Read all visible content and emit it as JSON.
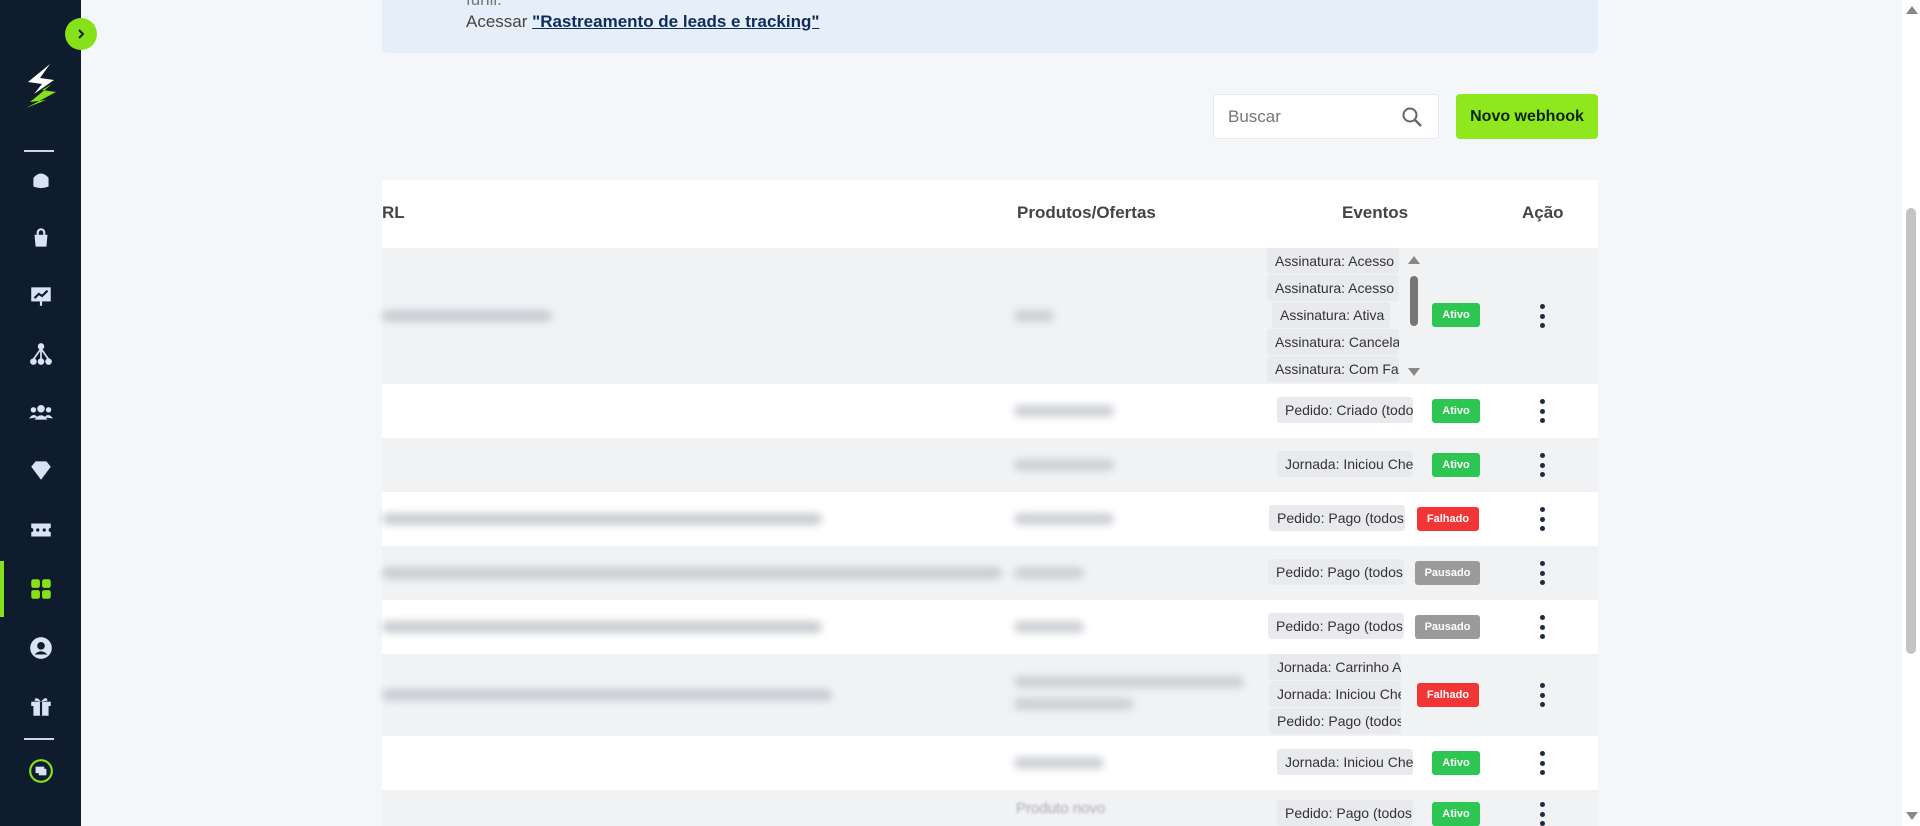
{
  "banner": {
    "prefix_line": "funil.",
    "access_text": "Acessar ",
    "link_text": "\"Rastreamento de leads e tracking\""
  },
  "search": {
    "placeholder": "Buscar"
  },
  "new_button": {
    "label": "Novo webhook"
  },
  "table": {
    "headers": {
      "url": "RL",
      "products": "Produtos/Ofertas",
      "events": "Eventos",
      "action": "Ação"
    },
    "rows": [
      {
        "events": [
          "Assinatura: Acesso L",
          "Assinatura: Acesso P",
          "Assinatura: Ativa",
          "Assinatura: Cancelad",
          "Assinatura: Com Fall"
        ],
        "status": "Ativo"
      },
      {
        "events": [
          "Pedido: Criado (todos"
        ],
        "status": "Ativo"
      },
      {
        "events": [
          "Jornada: Iniciou Che"
        ],
        "status": "Ativo"
      },
      {
        "events": [
          "Pedido: Pago (todos"
        ],
        "status": "Falhado"
      },
      {
        "events": [
          "Pedido: Pago (todos"
        ],
        "status": "Pausado"
      },
      {
        "events": [
          "Pedido: Pago (todos"
        ],
        "status": "Pausado"
      },
      {
        "events": [
          "Jornada: Carrinho Ab",
          "Jornada: Iniciou Che",
          "Pedido: Pago (todos"
        ],
        "status": "Falhado"
      },
      {
        "events": [
          "Jornada: Iniciou Che"
        ],
        "status": "Ativo"
      },
      {
        "products": "Produto novo",
        "events": [
          "Pedido: Pago (todos"
        ],
        "status": "Ativo"
      }
    ]
  },
  "colors": {
    "sidebar": "#0f1c2e",
    "accent": "#86e11b",
    "ativo": "#2dc653",
    "falhado": "#f23535",
    "pausado": "#9a9a9a"
  },
  "sidebar_icons": [
    "home-icon",
    "bag-icon",
    "presentation-chart-icon",
    "network-icon",
    "users-icon",
    "diamond-icon",
    "ticket-icon",
    "apps-grid-icon",
    "user-circle-icon",
    "gift-icon",
    "chat-icon"
  ]
}
